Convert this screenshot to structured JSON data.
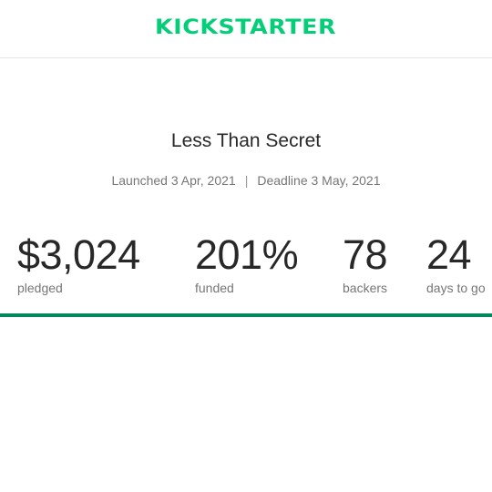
{
  "header": {
    "logo_text": "KICKSTARTER",
    "accent": "#05ce78"
  },
  "project": {
    "title": "Less Than Secret",
    "launched": "Launched 3 Apr, 2021",
    "separator": "|",
    "deadline": "Deadline 3 May, 2021"
  },
  "stats": {
    "pledged": {
      "value": "$3,024",
      "label": "pledged"
    },
    "funded": {
      "value": "201%",
      "label": "funded"
    },
    "backers": {
      "value": "78",
      "label": "backers"
    },
    "days": {
      "value": "24",
      "label": "days to go"
    }
  },
  "progress": {
    "percent": 100,
    "color": "#028858"
  }
}
